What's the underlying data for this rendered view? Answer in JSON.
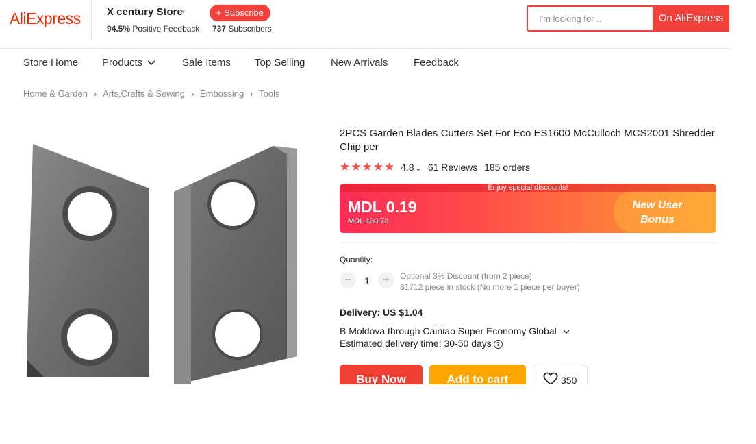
{
  "header": {
    "logo": "AliExpress",
    "store_name": "X century Store",
    "subscribe_label": "+ Subscribe",
    "feedback_pct": "94.5%",
    "feedback_label": "Positive Feedback",
    "subscribers_count": "737",
    "subscribers_label": "Subscribers",
    "search_placeholder": "I'm looking for ..",
    "search_button": "On AliExpress"
  },
  "nav": [
    "Store Home",
    "Products",
    "Sale Items",
    "Top Selling",
    "New Arrivals",
    "Feedback"
  ],
  "breadcrumbs": [
    "Home & Garden",
    "Arts,Crafts & Sewing",
    "Embossing",
    "Tools"
  ],
  "product": {
    "title": "2PCS Garden Blades Cutters Set For Eco ES1600 McCulloch MCS2001 Shredder Chip per",
    "stars": "★★★★★",
    "rating": "4.8",
    "reviews": "61 Reviews",
    "orders": "185 orders",
    "promo_banner": "Enjoy special discounts!",
    "price": "MDL 0.19",
    "old_price": "MDL 130.73",
    "bonus_line1": "New User",
    "bonus_line2": "Bonus",
    "quantity_label": "Quantity:",
    "quantity_value": "1",
    "discount_note": "Optional 3% Discount (from 2 piece)",
    "stock_note": "81712 piece in stock (No more 1 piece per buyer)",
    "delivery_title": "Delivery: US $1.04",
    "shipping_line": "B Moldova through Cainiao Super Economy Global",
    "eta_line": "Estimated delivery time: 30-50 days",
    "buy_label": "Buy Now",
    "cart_label": "Add to cart",
    "wish_count": "350"
  },
  "colors": {
    "brand": "#e62e04",
    "accent": "#f2413b",
    "cart": "#fea600"
  }
}
